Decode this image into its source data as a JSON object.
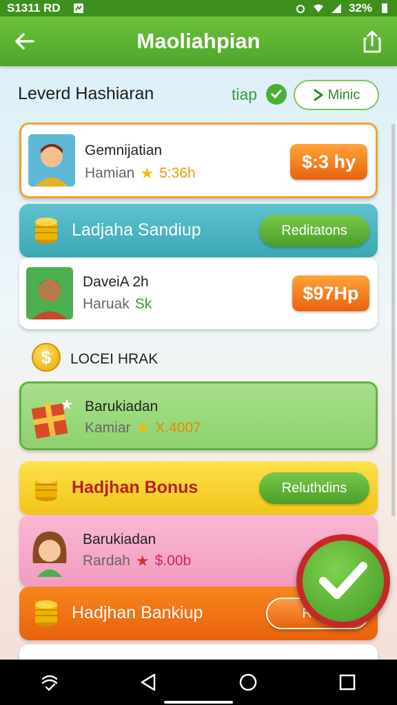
{
  "status_bar": {
    "left_text": "S1311 RD",
    "battery": "32%"
  },
  "app_bar": {
    "title": "Maoliahpian"
  },
  "header": {
    "title": "Leverd Hashiaran",
    "tap_label": "tiap",
    "mini_button": "Minic"
  },
  "items": [
    {
      "name": "Gemnijatian",
      "sub": "Hamian",
      "rating": "5:36h",
      "price": "$:3 hy"
    },
    {
      "name": "DaveiA 2h",
      "sub": "Haruak",
      "rating": "Sk",
      "price": "$97Hp"
    },
    {
      "name": "Barukiadan",
      "sub": "Kamiar",
      "rating": "X.4007",
      "price": ""
    },
    {
      "name": "Barukiadan",
      "sub": "Rardah",
      "rating": "$.00b",
      "price": ""
    }
  ],
  "banners": [
    {
      "label": "Ladjaha Sandiup",
      "button": "Reditatons"
    },
    {
      "label": "Hadjhan Bonus",
      "button": "Reluthdins"
    },
    {
      "label": "Hadjhan Bankiup",
      "button": "Relai"
    }
  ],
  "local_label": "LOCEI HRAK",
  "colors": {
    "primary_green": "#4ea52a",
    "orange": "#e8620d",
    "teal": "#49b3bf",
    "yellow": "#f5cf2a",
    "pink": "#f6a9c8"
  }
}
